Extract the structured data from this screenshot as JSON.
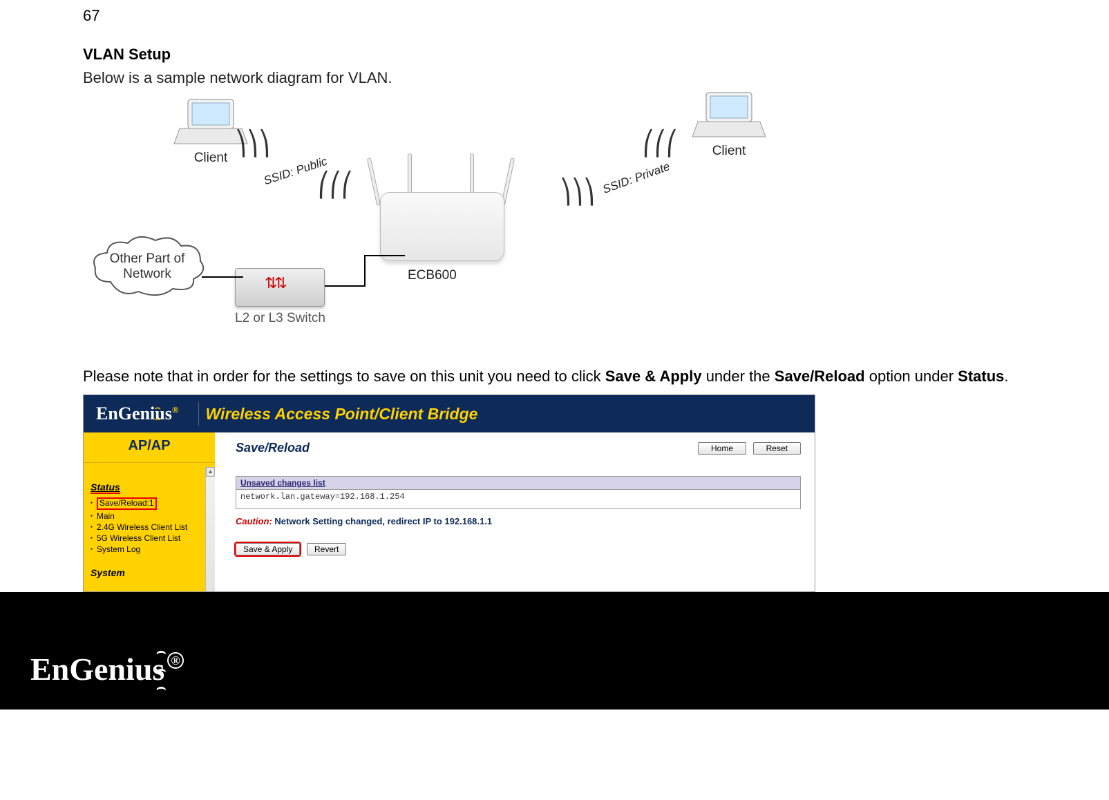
{
  "page_number": "67",
  "section_title": "VLAN Setup",
  "intro_text": "Below is a sample network diagram for VLAN.",
  "diagram": {
    "client_left": "Client",
    "client_right": "Client",
    "ssid_public": "SSID: Public",
    "ssid_private": "SSID: Private",
    "ap_model": "ECB600",
    "switch_label": "L2 or L3 Switch",
    "cloud_line1": "Other Part of",
    "cloud_line2": "Network"
  },
  "note": {
    "prefix": "Please note that in order for the settings to save on this unit you need to click ",
    "bold1": "Save & Apply",
    "mid": " under the ",
    "bold2": "Save/Reload",
    "suffix1": " option under ",
    "bold3": "Status",
    "suffix2": "."
  },
  "ui": {
    "logo": "EnGenius",
    "logo_sup": "®",
    "header_title": "Wireless Access Point/Client Bridge",
    "mode": "AP/AP",
    "sidebar": {
      "status_head": "Status",
      "save_reload": "Save/Reload:1",
      "main": "Main",
      "wcl24": "2.4G Wireless Client List",
      "wcl5": "5G Wireless Client List",
      "syslog": "System Log",
      "system_head": "System"
    },
    "content": {
      "page_title": "Save/Reload",
      "home_btn": "Home",
      "reset_btn": "Reset",
      "panel_head": "Unsaved changes list",
      "panel_body": "network.lan.gateway=192.168.1.254",
      "caution_label": "Caution:",
      "caution_msg": "  Network Setting changed, redirect IP to 192.168.1.1",
      "save_apply": "Save & Apply",
      "revert": "Revert"
    }
  },
  "footer": {
    "logo": "EnGenius",
    "reg": "®"
  }
}
